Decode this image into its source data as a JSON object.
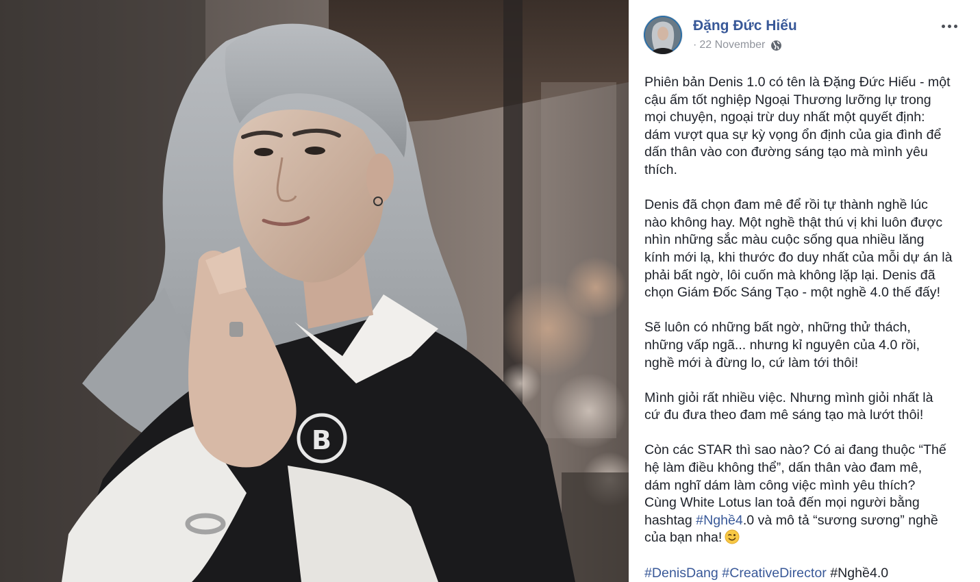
{
  "photo": {
    "alt": "",
    "icon": "portrait-photo"
  },
  "post": {
    "author": "Đặng Đức Hiếu",
    "separator": "·",
    "date": "22 November",
    "privacy_icon": "globe-icon",
    "more_icon": "more-options-icon",
    "paragraphs": [
      [
        "Phiên bản Denis 1.0 có tên là Đặng Đức Hiếu - một",
        "cậu ấm tốt nghiệp Ngoại Thương lưỡng lự trong",
        "mọi chuyện, ngoại trừ duy nhất một quyết định:",
        "dám vượt qua sự kỳ vọng ổn định của gia đình để",
        "dấn thân vào con đường sáng tạo mà mình yêu",
        "thích."
      ],
      [
        "Denis đã chọn đam mê để rồi tự thành nghề lúc",
        "nào không hay. Một nghề thật thú vị khi luôn được",
        "nhìn những sắc màu cuộc sống qua nhiều lăng",
        "kính mới lạ, khi thước đo duy nhất của mỗi dự án là",
        "phải bất ngờ, lôi cuốn mà không lặp lại. Denis đã",
        "chọn Giám Đốc Sáng Tạo - một nghề 4.0 thế đấy!"
      ],
      [
        "Sẽ luôn có những bất ngờ, những thử thách,",
        "những vấp ngã... nhưng kỉ nguyên của 4.0 rồi,",
        "nghề mới à đừng lo, cứ làm tới thôi!"
      ],
      [
        "Mình giỏi rất nhiều việc. Nhưng mình giỏi nhất là",
        "cứ đu đưa theo đam mê sáng tạo mà lướt thôi!"
      ],
      [
        "Còn các STAR thì sao nào? Có ai đang thuộc “Thế",
        "hệ làm điều không thể”, dấn thân vào đam mê,",
        "dám nghĩ dám làm công việc mình yêu thích?",
        "Cùng White Lotus lan toả đến mọi người bằng"
      ]
    ],
    "last_para": {
      "line1_before": "hashtag ",
      "line1_tag": "#Nghề4",
      "line1_after": ".0 và mô tả “sương sương” nghề",
      "line2_text": "của bạn nha!",
      "emoji_icon": "wink-emoji-icon"
    },
    "tags": {
      "tag1": "#DenisDang",
      "tag2": "#CreativeDirector",
      "tag3": "#Nghề4.0"
    }
  },
  "colors": {
    "link": "#385898",
    "text": "#1d2129",
    "meta": "#90949c"
  }
}
